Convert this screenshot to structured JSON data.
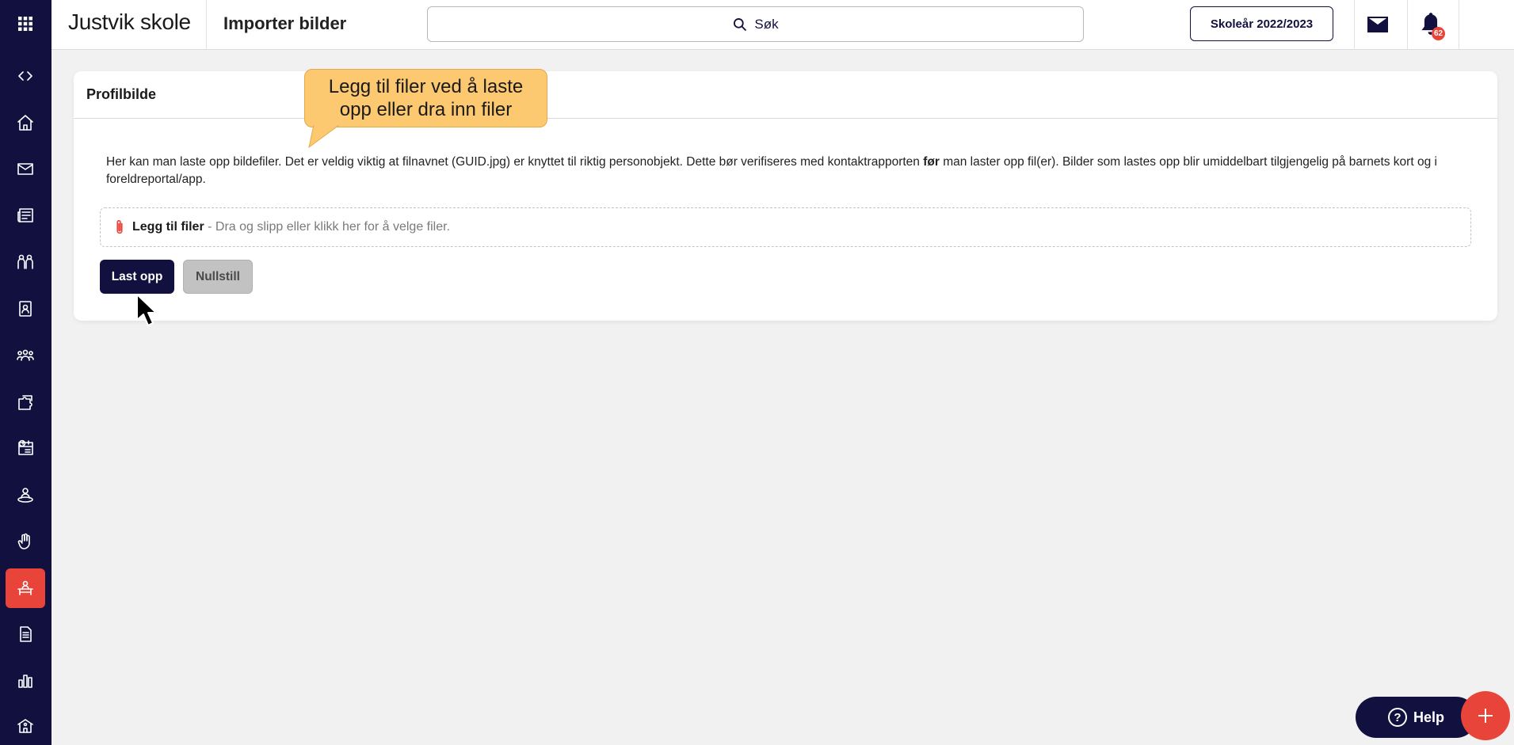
{
  "header": {
    "school_name": "Justvik skole",
    "page_title": "Importer bilder",
    "search_label": "Søk",
    "school_year": "Skoleår 2022/2023",
    "notification_count": "62"
  },
  "sidebar": {
    "items": [
      {
        "icon": "apps-grid-icon"
      },
      {
        "icon": "code-toggle-icon"
      },
      {
        "icon": "home-icon"
      },
      {
        "icon": "mail-icon"
      },
      {
        "icon": "news-icon"
      },
      {
        "icon": "groups-icon"
      },
      {
        "icon": "contact-card-icon"
      },
      {
        "icon": "people-icon"
      },
      {
        "icon": "puzzle-icon"
      },
      {
        "icon": "calendar-person-icon"
      },
      {
        "icon": "person-location-icon"
      },
      {
        "icon": "hand-icon"
      },
      {
        "icon": "person-desk-icon",
        "active": true
      },
      {
        "icon": "document-icon"
      },
      {
        "icon": "bar-chart-icon"
      },
      {
        "icon": "school-icon"
      }
    ],
    "active_color": "#e8443a",
    "background": "#11103e"
  },
  "card": {
    "title": "Profilbilde",
    "description_part1": "Her kan man laste opp bildefiler. Det er veldig viktig at filnavnet (GUID.jpg) er knyttet til riktig personobjekt. Dette bør verifiseres med kontaktrapporten ",
    "description_bold": "før",
    "description_part2": " man laster opp fil(er). Bilder som lastes opp blir umiddelbart tilgjengelig på barnets kort og i foreldreportal/app.",
    "dropzone_label": "Legg til filer",
    "dropzone_hint": " - Dra og slipp eller klikk her for å velge filer.",
    "upload_button": "Last opp",
    "reset_button": "Nullstill"
  },
  "tooltip": {
    "text": "Legg til filer ved å laste opp eller dra inn filer",
    "color": "#fcc870"
  },
  "floating": {
    "help_label": "Help",
    "help_icon": "question-circle-icon",
    "fab_icon": "plus-icon"
  }
}
